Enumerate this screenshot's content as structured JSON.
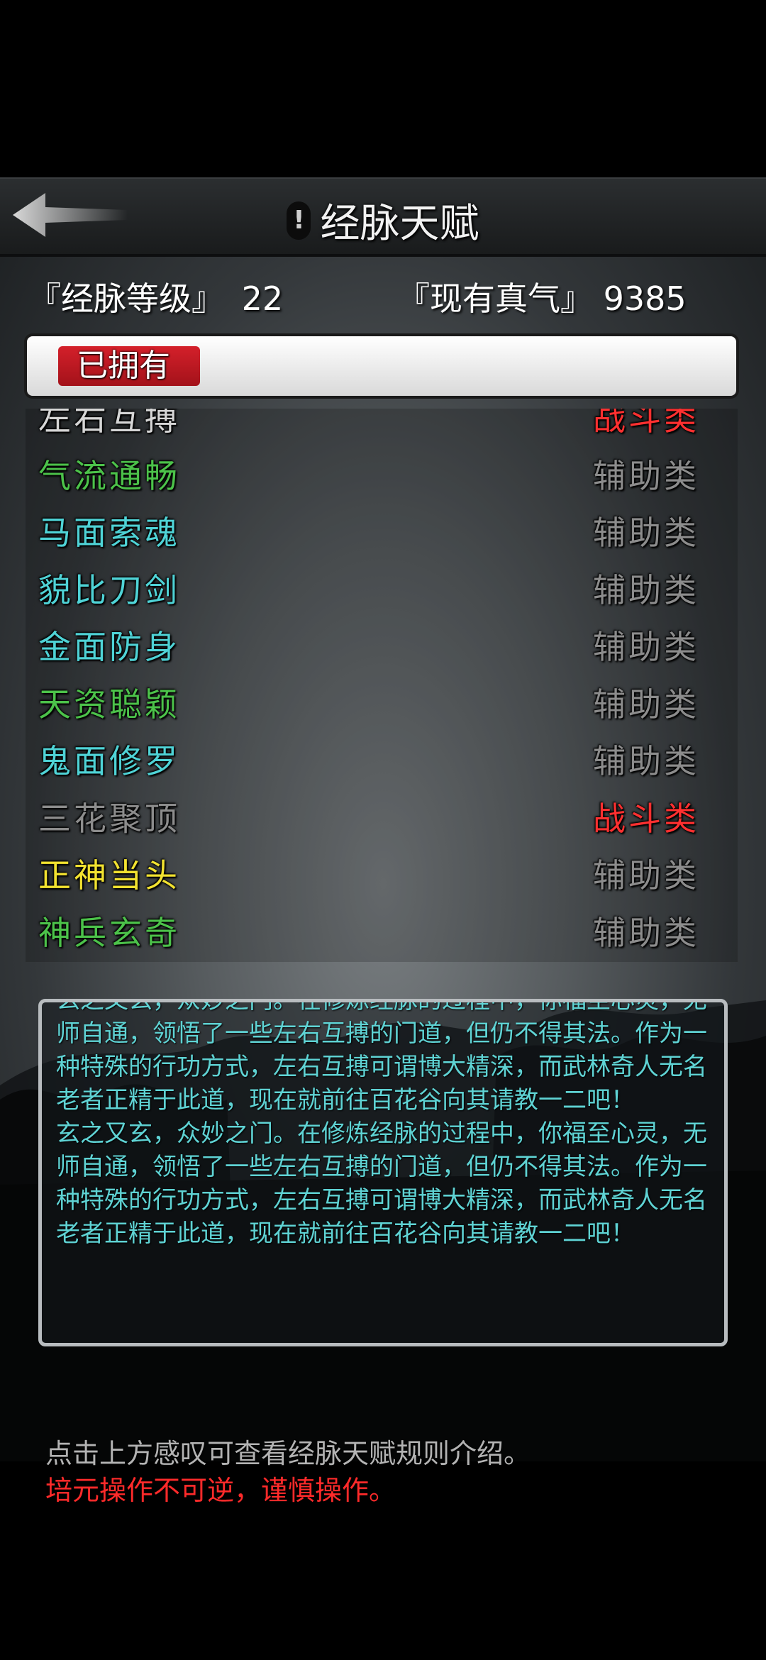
{
  "header": {
    "title": "经脉天赋",
    "help_mark": "!"
  },
  "stats": {
    "level_label": "『经脉等级』",
    "level_value": "22",
    "qi_label": "『现有真气』",
    "qi_value": "9385"
  },
  "tab": {
    "owned_label": "已拥有"
  },
  "talents": [
    {
      "name": "左右互搏",
      "type": "战斗类",
      "name_color": "#d6d6d6",
      "type_color": "#ff3030"
    },
    {
      "name": "气流通畅",
      "type": "辅助类",
      "name_color": "#4cc24a",
      "type_color": "#8c8c8c"
    },
    {
      "name": "马面索魂",
      "type": "辅助类",
      "name_color": "#4fd3d6",
      "type_color": "#8c8c8c"
    },
    {
      "name": "貌比刀剑",
      "type": "辅助类",
      "name_color": "#4fd3d6",
      "type_color": "#8c8c8c"
    },
    {
      "name": "金面防身",
      "type": "辅助类",
      "name_color": "#4fd3d6",
      "type_color": "#8c8c8c"
    },
    {
      "name": "天资聪颖",
      "type": "辅助类",
      "name_color": "#4cc24a",
      "type_color": "#8c8c8c"
    },
    {
      "name": "鬼面修罗",
      "type": "辅助类",
      "name_color": "#4fd3d6",
      "type_color": "#8c8c8c"
    },
    {
      "name": "三花聚顶",
      "type": "战斗类",
      "name_color": "#8c8c8c",
      "type_color": "#ff3030"
    },
    {
      "name": "正神当头",
      "type": "辅助类",
      "name_color": "#f2e230",
      "type_color": "#8c8c8c"
    },
    {
      "name": "神兵玄奇",
      "type": "辅助类",
      "name_color": "#4cc24a",
      "type_color": "#8c8c8c"
    }
  ],
  "description": {
    "paragraphs": [
      "玄之又玄，众妙之门。在修炼经脉的过程中，你福至心灵，无师自通，领悟了一些左右互搏的门道，但仍不得其法。作为一种特殊的行功方式，左右互搏可谓博大精深，而武林奇人无名老者正精于此道，现在就前往百花谷向其请教一二吧！",
      "玄之又玄，众妙之门。在修炼经脉的过程中，你福至心灵，无师自通，领悟了一些左右互搏的门道，但仍不得其法。作为一种特殊的行功方式，左右互搏可谓博大精深，而武林奇人无名老者正精于此道，现在就前往百花谷向其请教一二吧！"
    ]
  },
  "footer": {
    "hint": "点击上方感叹可查看经脉天赋规则介绍。",
    "warning": "培元操作不可逆，谨慎操作。"
  },
  "icons": {
    "back": "arrow-left-icon"
  }
}
